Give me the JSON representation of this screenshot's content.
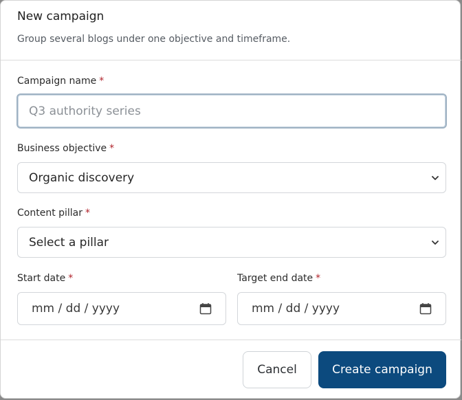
{
  "dialog": {
    "title": "New campaign",
    "subtitle": "Group several blogs under one objective and timeframe."
  },
  "form": {
    "required_mark": "*",
    "campaign_name": {
      "label": "Campaign name",
      "placeholder": "Q3 authority series",
      "value": ""
    },
    "business_objective": {
      "label": "Business objective",
      "selected": "Organic discovery"
    },
    "content_pillar": {
      "label": "Content pillar",
      "selected": "Select a pillar"
    },
    "start_date": {
      "label": "Start date",
      "placeholder": "mm / dd / yyyy"
    },
    "target_end_date": {
      "label": "Target end date",
      "placeholder": "mm / dd / yyyy"
    }
  },
  "actions": {
    "cancel_label": "Cancel",
    "create_label": "Create campaign"
  },
  "colors": {
    "primary": "#0c4a7e",
    "required": "#b0232b",
    "focus_border": "#9fb2c3"
  },
  "icons": {
    "select": "chevron-down-icon",
    "date": "calendar-icon"
  }
}
